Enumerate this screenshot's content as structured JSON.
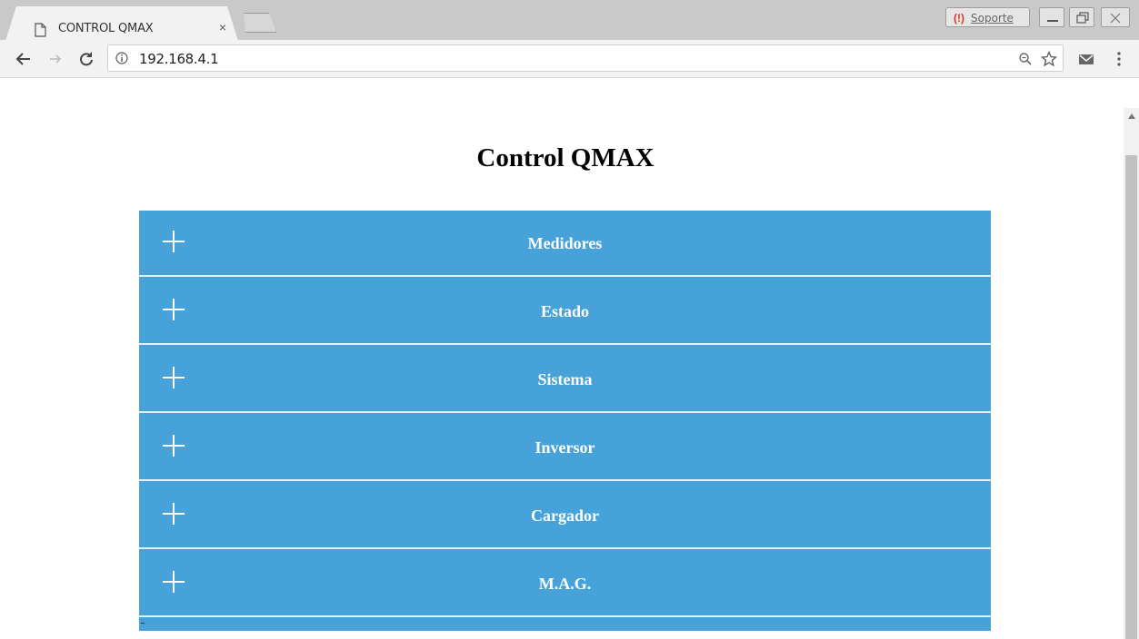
{
  "browser": {
    "tab_title": "CONTROL QMAX",
    "tab_close": "×",
    "support_label": "Soporte",
    "support_icon": "(!)",
    "url": "192.168.4.1"
  },
  "page": {
    "title": "Control QMAX",
    "accent_color": "#47a2da",
    "sections": [
      {
        "label": "Medidores"
      },
      {
        "label": "Estado"
      },
      {
        "label": "Sistema"
      },
      {
        "label": "Inversor"
      },
      {
        "label": "Cargador"
      },
      {
        "label": "M.A.G."
      }
    ]
  }
}
